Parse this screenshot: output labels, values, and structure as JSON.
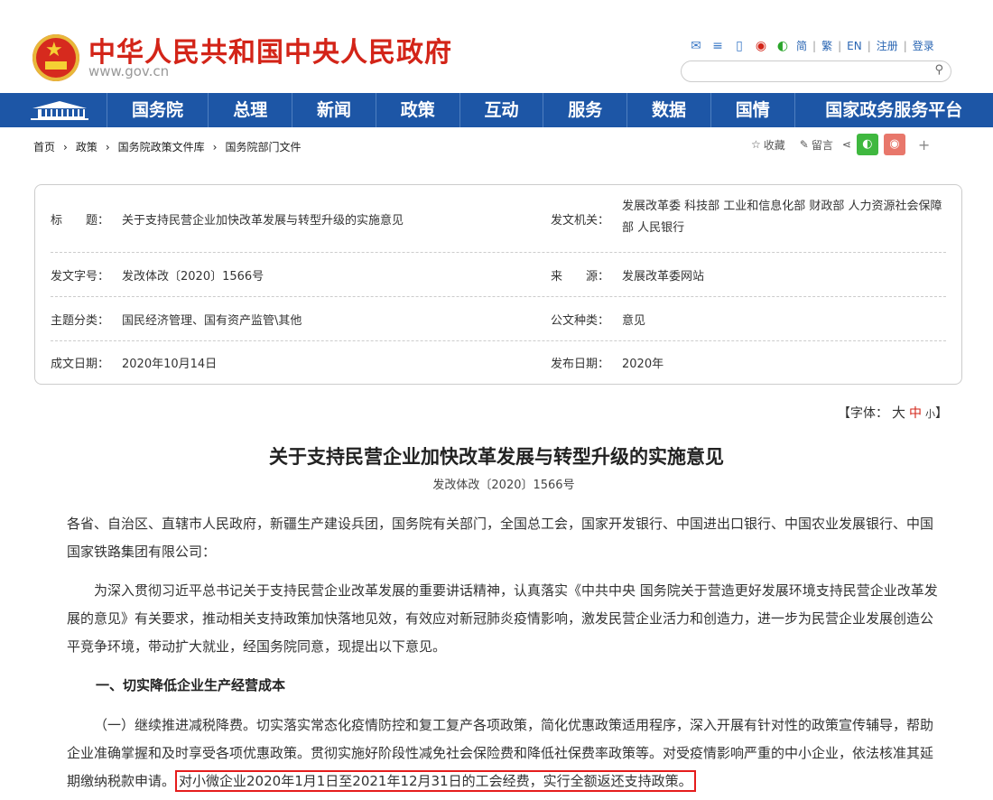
{
  "header": {
    "site_title": "中华人民共和国中央人民政府",
    "site_url": "www.gov.cn",
    "tools": [
      "简",
      "繁",
      "EN",
      "注册",
      "登录"
    ],
    "search_placeholder": ""
  },
  "nav": {
    "items": [
      "国务院",
      "总理",
      "新闻",
      "政策",
      "互动",
      "服务",
      "数据",
      "国情",
      "国家政务服务平台"
    ]
  },
  "breadcrumb": {
    "items": [
      "首页",
      "政策",
      "国务院政策文件库",
      "国务院部门文件"
    ]
  },
  "share": {
    "favorite": "收藏",
    "comment": "留言",
    "plus": "+"
  },
  "meta": {
    "title_label": "标　　题：",
    "title_value": "关于支持民营企业加快改革发展与转型升级的实施意见",
    "issuer_label": "发文机关：",
    "issuer_value": "发展改革委  科技部  工业和信息化部  财政部  人力资源社会保障部  人民银行",
    "doc_no_label": "发文字号：",
    "doc_no_value": "发改体改〔2020〕1566号",
    "source_label": "来　　源：",
    "source_value": "发展改革委网站",
    "topic_label": "主题分类：",
    "topic_value": "国民经济管理、国有资产监管\\其他",
    "type_label": "公文种类：",
    "type_value": "意见",
    "date_label": "成文日期：",
    "date_value": "2020年10月14日",
    "pub_label": "发布日期：",
    "pub_value": "2020年"
  },
  "fontsize": {
    "prefix": "【字体：",
    "large": "大",
    "medium": "中",
    "small": "小",
    "suffix": "】"
  },
  "article": {
    "title": "关于支持民营企业加快改革发展与转型升级的实施意见",
    "doc_number": "发改体改〔2020〕1566号",
    "p1": "各省、自治区、直辖市人民政府，新疆生产建设兵团，国务院有关部门，全国总工会，国家开发银行、中国进出口银行、中国农业发展银行、中国国家铁路集团有限公司：",
    "p2": "为深入贯彻习近平总书记关于支持民营企业改革发展的重要讲话精神，认真落实《中共中央 国务院关于营造更好发展环境支持民营企业改革发展的意见》有关要求，推动相关支持政策加快落地见效，有效应对新冠肺炎疫情影响，激发民营企业活力和创造力，进一步为民营企业发展创造公平竞争环境，带动扩大就业，经国务院同意，现提出以下意见。",
    "h1": "一、切实降低企业生产经营成本",
    "p3_main": "（一）继续推进减税降费。切实落实常态化疫情防控和复工复产各项政策，简化优惠政策适用程序，深入开展有针对性的政策宣传辅导，帮助企业准确掌握和及时享受各项优惠政策。贯彻实施好阶段性减免社会保险费和降低社保费率政策等。对受疫情影响严重的中小企业，依法核准其延期缴纳税款申请。",
    "p3_highlight": "对小微企业2020年1月1日至2021年12月31日的工会经费，实行全额返还支持政策。"
  }
}
